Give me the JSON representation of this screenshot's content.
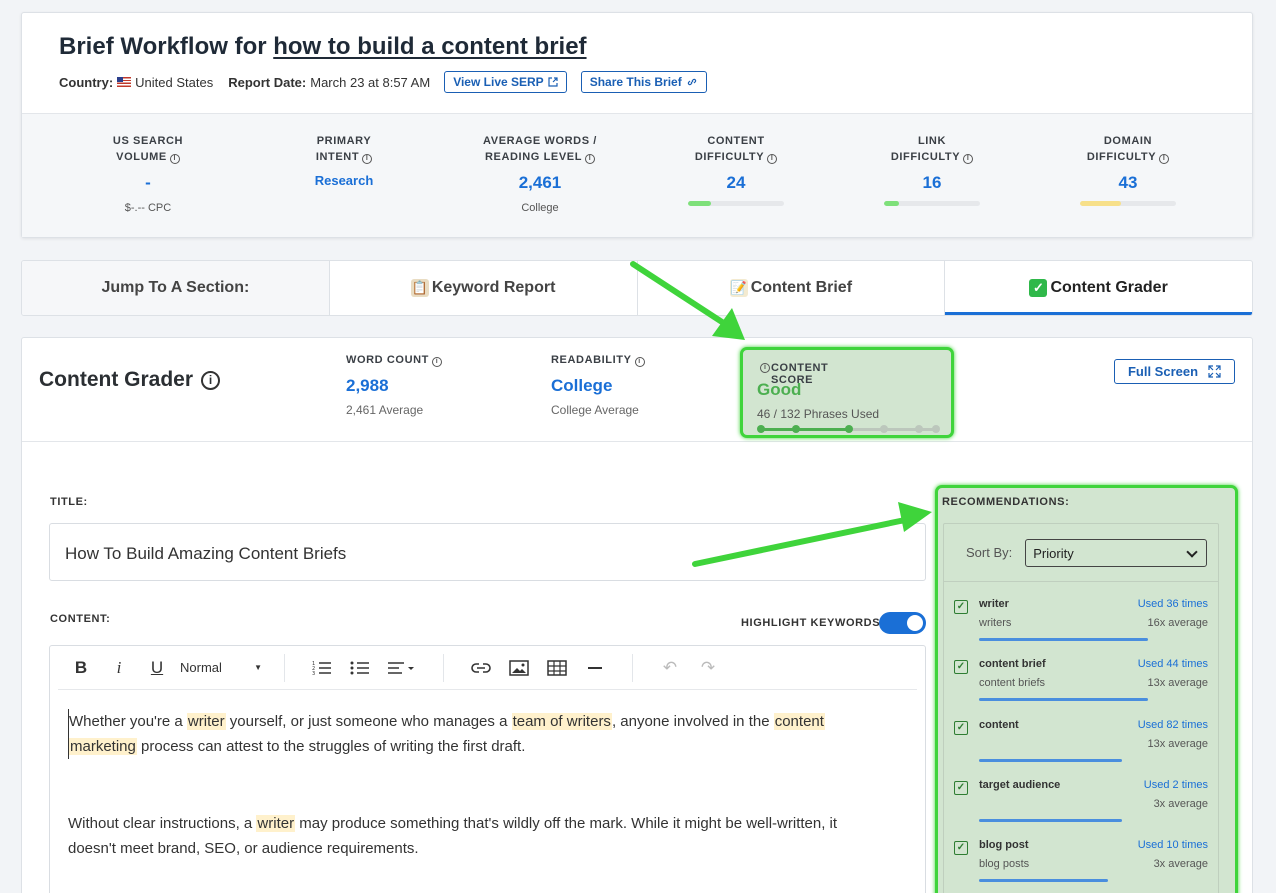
{
  "header": {
    "title_prefix": "Brief Workflow for",
    "title_keyword": "how to build a content brief",
    "country_label": "Country:",
    "country_value": "United States",
    "report_date_label": "Report Date:",
    "report_date_value": "March 23 at 8:57 AM",
    "view_serp_label": "View Live SERP",
    "share_label": "Share This Brief"
  },
  "metrics": [
    {
      "label_1": "US SEARCH",
      "label_2": "VOLUME",
      "value": "-",
      "sub": "$-.-- CPC"
    },
    {
      "label_1": "PRIMARY",
      "label_2": "INTENT",
      "value": "Research",
      "sub": ""
    },
    {
      "label_1": "AVERAGE WORDS /",
      "label_2": "READING LEVEL",
      "value": "2,461",
      "sub": "College"
    },
    {
      "label_1": "CONTENT",
      "label_2": "DIFFICULTY",
      "value": "24",
      "level": 0.24,
      "color": "#7ee07a"
    },
    {
      "label_1": "LINK",
      "label_2": "DIFFICULTY",
      "value": "16",
      "level": 0.16,
      "color": "#7ee07a"
    },
    {
      "label_1": "DOMAIN",
      "label_2": "DIFFICULTY",
      "value": "43",
      "level": 0.43,
      "color": "#f7e08a"
    }
  ],
  "tabs": {
    "jump_label": "Jump To A Section:",
    "keyword_report": "Keyword Report",
    "content_brief": "Content Brief",
    "content_grader": "Content Grader"
  },
  "grader": {
    "title": "Content Grader",
    "word_count_label": "WORD COUNT",
    "word_count_value": "2,988",
    "word_count_sub": "2,461 Average",
    "readability_label": "READABILITY",
    "readability_value": "College",
    "readability_sub": "College Average",
    "score_label": "CONTENT SCORE",
    "score_value": "Good",
    "score_sub": "46 / 132 Phrases Used",
    "score_level": 0.5,
    "full_screen_label": "Full Screen",
    "title_label": "TITLE:",
    "title_value": "How To Build Amazing Content Briefs",
    "content_label": "CONTENT:",
    "highlight_label": "HIGHLIGHT KEYWORDS",
    "format_value": "Normal"
  },
  "content": {
    "p1_a": "Whether you're a ",
    "p1_k1": "writer",
    "p1_b": " yourself, or just someone who manages a ",
    "p1_k2": "team of writers",
    "p1_c": ", anyone involved in the ",
    "p1_k3a": "content",
    "p1_k3b": "marketing",
    "p1_d": " process can attest to the struggles of writing the first draft.",
    "p2_a": "Without clear instructions, a ",
    "p2_k1": "writer",
    "p2_b": " may produce something that's wildly off the mark. While it might be well-written, it doesn't meet brand, SEO, or audience requirements."
  },
  "recommendations": {
    "label": "RECOMMENDATIONS:",
    "sort_label": "Sort By:",
    "sort_value": "Priority",
    "items": [
      {
        "name": "writer",
        "used": "Used 36 times",
        "variant": "writers",
        "avg": "16x average",
        "progress": 0.71
      },
      {
        "name": "content brief",
        "used": "Used 44 times",
        "variant": "content briefs",
        "avg": "13x average",
        "progress": 0.71
      },
      {
        "name": "content",
        "used": "Used 82 times",
        "variant": "",
        "avg": "13x average",
        "progress": 0.6
      },
      {
        "name": "target audience",
        "used": "Used 2 times",
        "variant": "",
        "avg": "3x average",
        "progress": 0.6
      },
      {
        "name": "blog post",
        "used": "Used 10 times",
        "variant": "blog posts",
        "avg": "3x average",
        "progress": 0.54
      }
    ]
  }
}
